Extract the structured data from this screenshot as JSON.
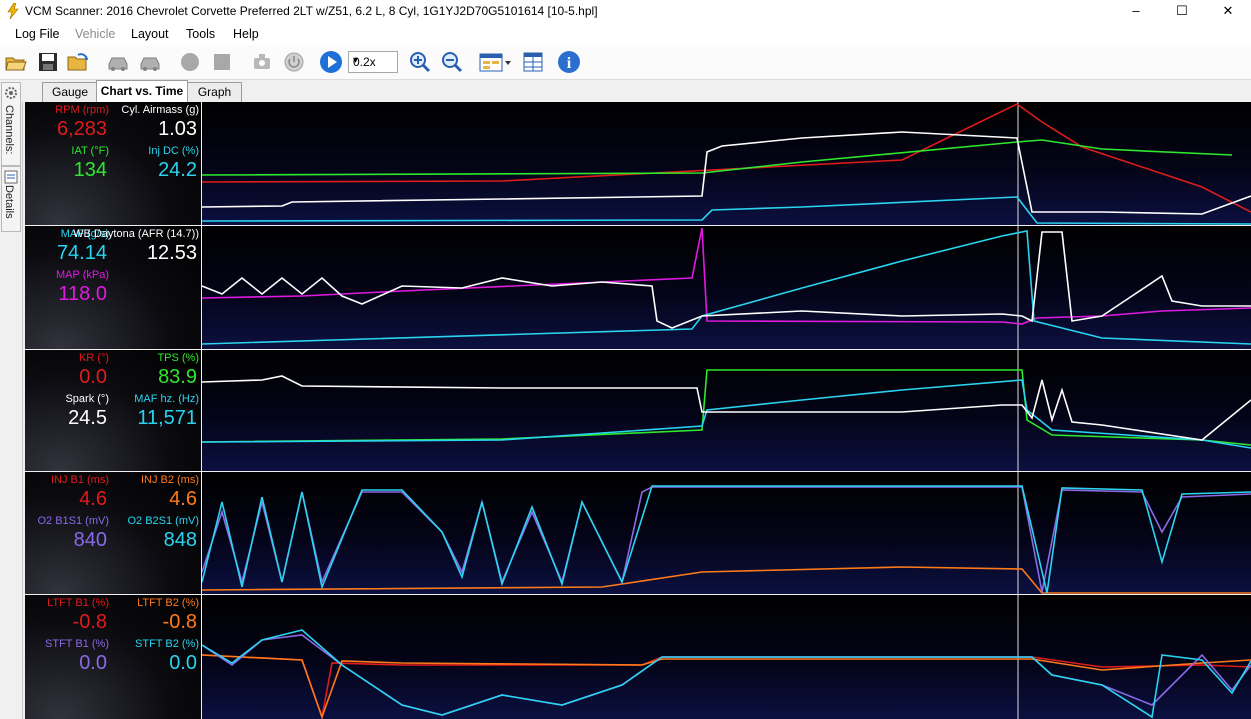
{
  "window": {
    "title": "VCM Scanner: 2016 Chevrolet Corvette Preferred 2LT w/Z51, 6.2 L, 8 Cyl, 1G1YJ2D70G5101614 [10-5.hpl]",
    "minimize": "–",
    "maximize": "☐",
    "close": "✕"
  },
  "menu": [
    "Log File",
    "Vehicle",
    "Layout",
    "Tools",
    "Help"
  ],
  "toolbar": {
    "icons": [
      "open-folder-icon",
      "save-icon",
      "save-as-icon",
      "vehicle-connect-icon",
      "vehicle-disconnect-icon",
      "record-icon",
      "stop-icon",
      "scanner-icon",
      "power-icon",
      "play-icon",
      "zoom-in-icon",
      "zoom-out-icon",
      "layout-icon",
      "columns-icon",
      "info-icon"
    ],
    "playback_speed": "0.2x"
  },
  "side_tabs": [
    "Channels:",
    "Details"
  ],
  "tabs": [
    "Gauge",
    "Chart vs. Time",
    "Graph"
  ],
  "active_tab": "Chart vs. Time",
  "panels": [
    {
      "channels": [
        {
          "label": "RPM (rpm)",
          "value": "6,283",
          "color": "#e01b1b"
        },
        {
          "label": "Cyl. Airmass (g)",
          "value": "1.03",
          "color": "#ffffff"
        },
        {
          "label": "IAT (°F)",
          "value": "134",
          "color": "#2ee82e"
        },
        {
          "label": "Inj DC (%)",
          "value": "24.2",
          "color": "#2ad4f0"
        }
      ]
    },
    {
      "channels": [
        {
          "label": "MAF (g/s)",
          "value": "74.14",
          "color": "#2ad4f0"
        },
        {
          "label": "WB Daytona (AFR (14.7))",
          "value": "12.53",
          "color": "#ffffff"
        },
        {
          "label": "MAP (kPa)",
          "value": "118.0",
          "color": "#e01be0"
        }
      ]
    },
    {
      "channels": [
        {
          "label": "KR (°)",
          "value": "0.0",
          "color": "#e01b1b"
        },
        {
          "label": "TPS (%)",
          "value": "83.9",
          "color": "#2ee82e"
        },
        {
          "label": "Spark (°)",
          "value": "24.5",
          "color": "#ffffff"
        },
        {
          "label": "MAF hz. (Hz)",
          "value": "11,571",
          "color": "#2ad4f0"
        }
      ]
    },
    {
      "channels": [
        {
          "label": "INJ B1 (ms)",
          "value": "4.6",
          "color": "#e01b1b"
        },
        {
          "label": "INJ B2 (ms)",
          "value": "4.6",
          "color": "#ff7a1a"
        },
        {
          "label": "O2 B1S1 (mV)",
          "value": "840",
          "color": "#8a6ae8"
        },
        {
          "label": "O2 B2S1 (mV)",
          "value": "848",
          "color": "#2ad4f0"
        }
      ]
    },
    {
      "channels": [
        {
          "label": "LTFT B1 (%)",
          "value": "-0.8",
          "color": "#e01b1b"
        },
        {
          "label": "LTFT B2 (%)",
          "value": "-0.8",
          "color": "#ff7a1a"
        },
        {
          "label": "STFT B1 (%)",
          "value": "0.0",
          "color": "#8a6ae8"
        },
        {
          "label": "STFT B2 (%)",
          "value": "0.0",
          "color": "#2ad4f0"
        }
      ]
    }
  ]
}
